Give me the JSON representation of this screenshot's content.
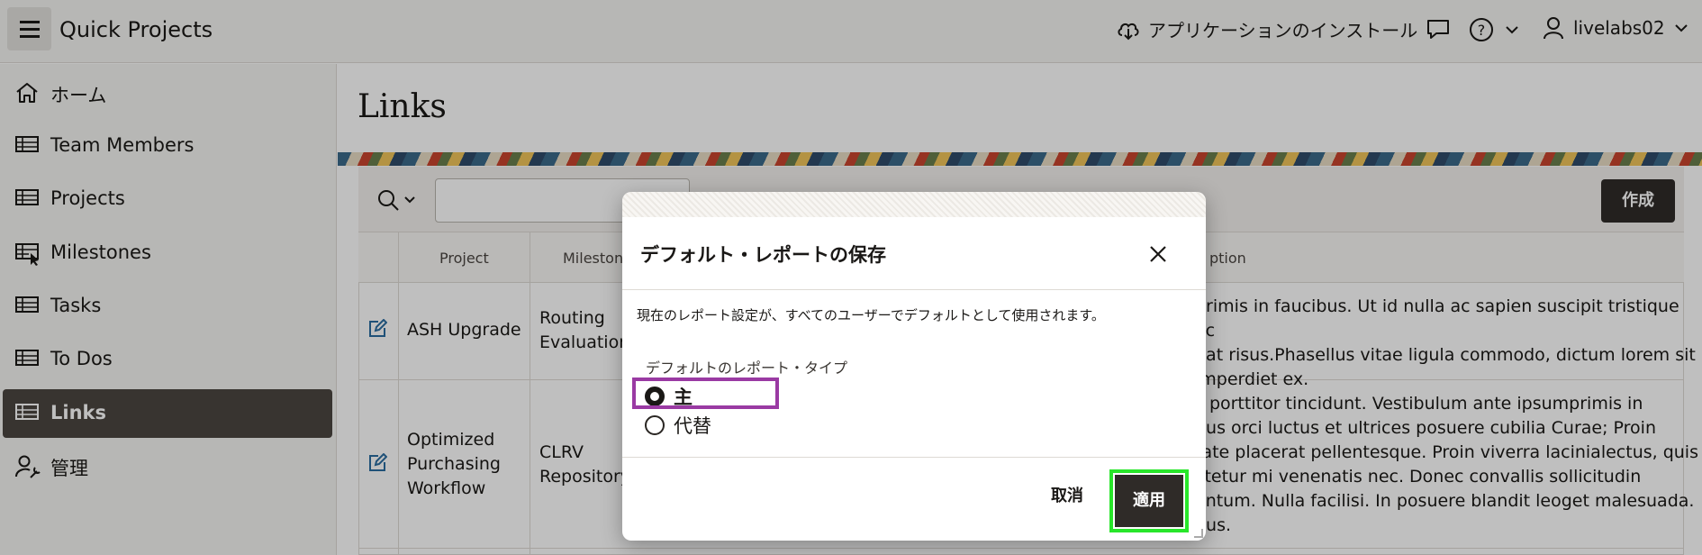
{
  "header": {
    "app_title": "Quick Projects",
    "install_label": "アプリケーションのインストール",
    "user_name": "livelabs02"
  },
  "sidebar": {
    "items": [
      {
        "label": "ホーム",
        "icon": "home-icon"
      },
      {
        "label": "Team Members",
        "icon": "table-icon"
      },
      {
        "label": "Projects",
        "icon": "table-icon"
      },
      {
        "label": "Milestones",
        "icon": "table-cursor-icon"
      },
      {
        "label": "Tasks",
        "icon": "table-icon"
      },
      {
        "label": "To Dos",
        "icon": "table-icon"
      },
      {
        "label": "Links",
        "icon": "table-icon",
        "active": true
      },
      {
        "label": "管理",
        "icon": "user-wrench-icon"
      }
    ]
  },
  "main": {
    "page_title": "Links",
    "create_button": "作成",
    "search_value": "",
    "columns": [
      "Project",
      "Mileston",
      "ption"
    ],
    "rows": [
      {
        "project": "ASH Upgrade",
        "milestone": [
          "Routing",
          "Evaluation"
        ],
        "description": [
          "primis in faucibus. Ut id nulla ac sapien suscipit tristique ac",
          "bat risus.Phasellus vitae ligula commodo, dictum lorem sit",
          "imperdiet ex."
        ]
      },
      {
        "project": [
          "Optimized",
          "Purchasing",
          "Workflow"
        ],
        "milestone": [
          "CLRV",
          "Repository"
        ],
        "description": [
          "s porttitor tincidunt. Vestibulum ante ipsumprimis in",
          "bus orci luctus et ultrices posuere cubilia Curae; Proin",
          "tate placerat pellentesque. Proin viverra lacinialectus, quis",
          "ctetur mi venenatis nec. Donec convallis sollicitudin",
          "entum. Nulla facilisi. In posuere blandit leoget malesuada.",
          "nus."
        ]
      }
    ]
  },
  "dialog": {
    "title": "デフォルト・レポートの保存",
    "description": "現在のレポート設定が、すべてのユーザーでデフォルトとして使用されます。",
    "type_label": "デフォルトのレポート・タイプ",
    "options": [
      {
        "label": "主",
        "checked": true
      },
      {
        "label": "代替",
        "checked": false
      }
    ],
    "cancel_label": "取消",
    "apply_label": "適用"
  },
  "colors": {
    "active_nav": "#4b4641",
    "primary_button": "#2f2b28",
    "highlight_option": "#9a3aa3",
    "highlight_apply": "#28e62a"
  }
}
